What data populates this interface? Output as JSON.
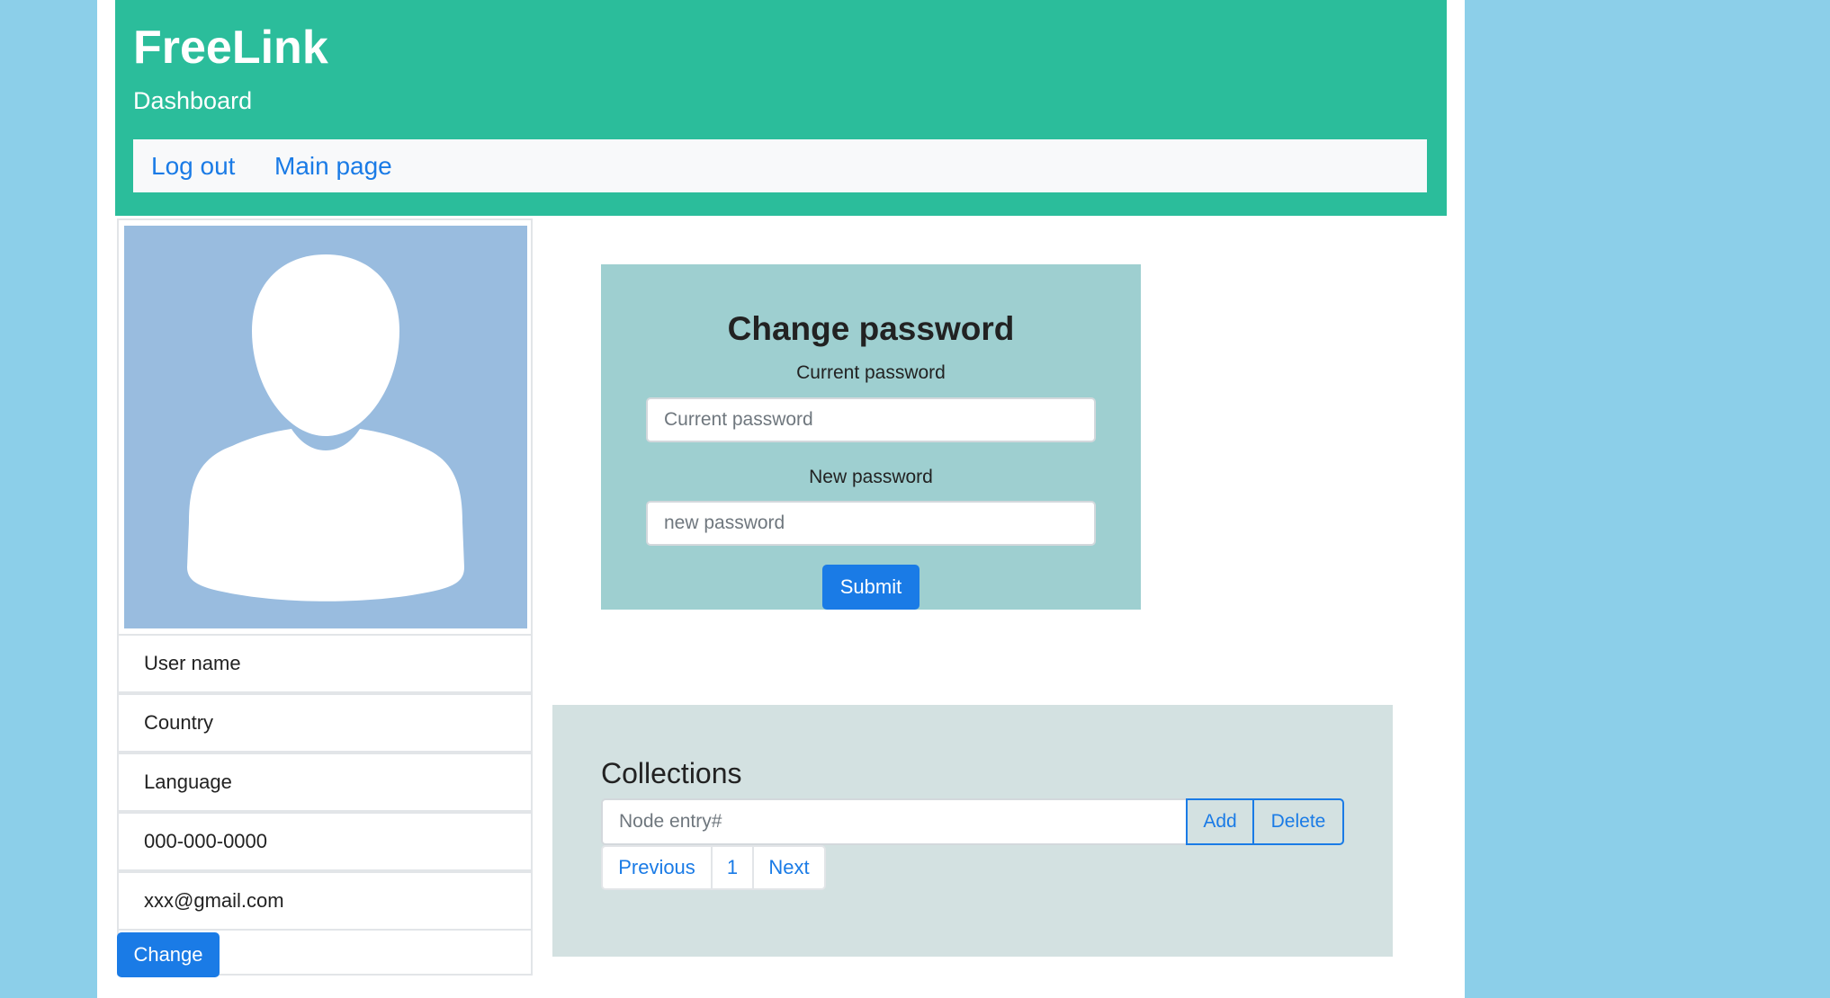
{
  "header": {
    "brand": "FreeLink",
    "subtitle": "Dashboard",
    "nav": {
      "logout": "Log out",
      "main_page": "Main page"
    }
  },
  "profile": {
    "avatar_icon": "user-silhouette-icon",
    "fields": [
      "User name",
      "Country",
      "Language",
      "000-000-0000",
      "xxx@gmail.com"
    ],
    "change_label": "Change"
  },
  "change_password": {
    "title": "Change password",
    "current_label": "Current password",
    "current_placeholder": "Current password",
    "current_value": "",
    "new_label": "New password",
    "new_placeholder": "new password",
    "new_value": "",
    "submit_label": "Submit"
  },
  "collections": {
    "title": "Collections",
    "input_placeholder": "Node entry#",
    "input_value": "",
    "add_label": "Add",
    "delete_label": "Delete",
    "pagination": {
      "previous": "Previous",
      "page": "1",
      "next": "Next"
    }
  },
  "colors": {
    "background": "#8ccfe9",
    "header": "#2bbd9b",
    "primary": "#1a7be6",
    "password_panel": "#9ecfd0",
    "collections_panel": "#d3e1e1",
    "avatar_bg": "#99bcdf"
  }
}
